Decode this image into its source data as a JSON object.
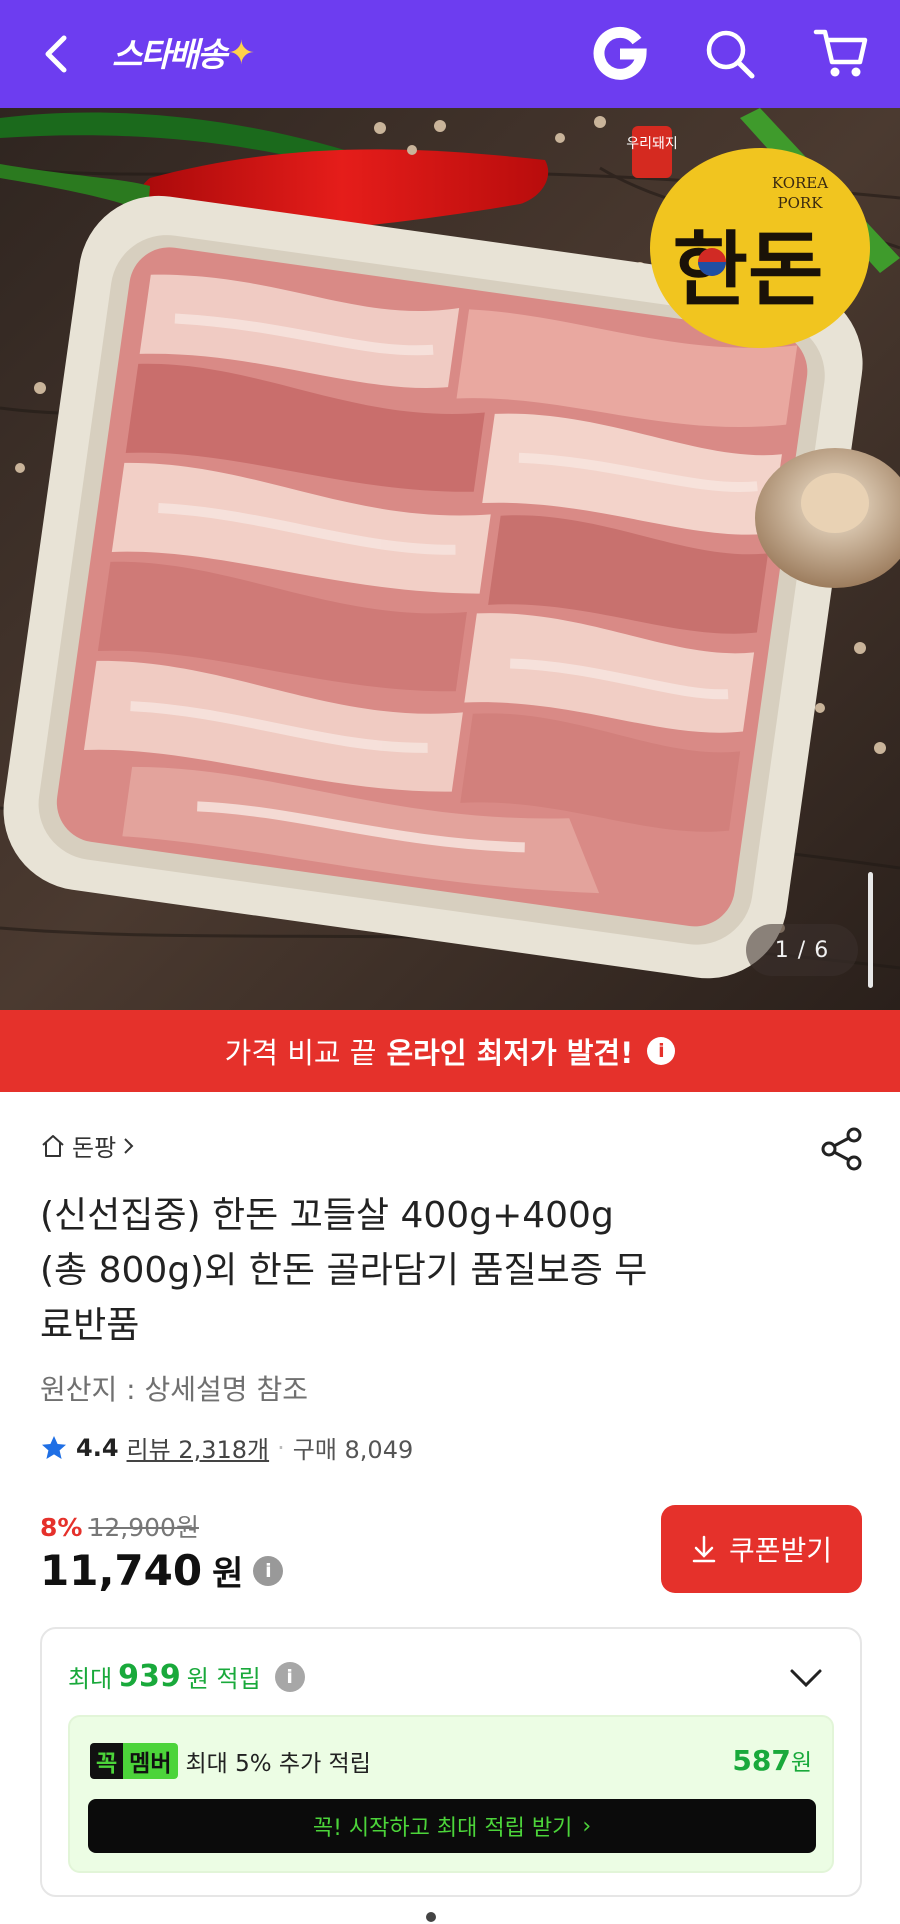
{
  "topbar": {
    "brand": "스타배송",
    "brand_spark": "✦",
    "bg_color": "#6d3df0"
  },
  "hero": {
    "counter": "1 / 6",
    "logo_badge": "우리돼지",
    "logo_text_en1": "KOREA",
    "logo_text_en2": "PORK",
    "logo_text_ko": "한돈"
  },
  "promo": {
    "text_normal": "가격 비교 끝",
    "text_bold": "온라인 최저가 발견!",
    "info_icon": "i",
    "color": "#e5312b"
  },
  "product": {
    "breadcrumb": "돈팡",
    "title_line1": "(신선집중) 한돈 꼬들살 400g+400g",
    "title_line2": "(총 800g)외 한돈 골라담기 품질보증 무",
    "title_line3": "료반품",
    "origin": "원산지 : 상세설명 참조",
    "rating": "4.4",
    "review_text": "리뷰 2,318개",
    "purchase_text": "구매 8,049",
    "discount_pct": "8%",
    "original_price": "12,900",
    "original_price_unit": "원",
    "price": "11,740",
    "price_unit": "원",
    "coupon_label": "쿠폰받기"
  },
  "reward": {
    "prefix": "최대",
    "amount": "939",
    "suffix": "원 적립",
    "member_badge_1": "꼭",
    "member_badge_2": "멤버",
    "member_text": "최대 5% 추가 적립",
    "member_points": "587",
    "member_points_unit": "원",
    "start_label": "꼭! 시작하고 최대 적립 받기",
    "start_arrow": "›"
  }
}
